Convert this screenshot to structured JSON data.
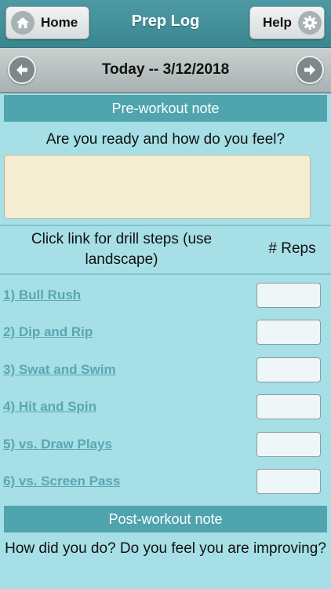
{
  "header": {
    "title": "Prep Log",
    "home_label": "Home",
    "help_label": "Help"
  },
  "icons": {
    "home": "home-icon",
    "help": "gear-icon",
    "prev": "arrow-left-icon",
    "next": "arrow-right-icon"
  },
  "date_nav": {
    "date_text": "Today -- 3/12/2018"
  },
  "pre_workout": {
    "heading": "Pre-workout note",
    "prompt": "Are you ready and how do you feel?"
  },
  "drills": {
    "column_title": "Click link for drill steps (use landscape)",
    "reps_title": "# Reps",
    "items": [
      {
        "label": "1) Bull Rush"
      },
      {
        "label": "2) Dip and Rip"
      },
      {
        "label": "3) Swat and Swim"
      },
      {
        "label": "4) Hit and Spin"
      },
      {
        "label": "5) vs. Draw Plays"
      },
      {
        "label": "6) vs. Screen Pass"
      }
    ]
  },
  "post_workout": {
    "heading": "Post-workout note",
    "prompt": "How did you do? Do you feel you are improving?"
  },
  "colors": {
    "header": "#3f8c96",
    "section": "#4fa4ae",
    "background": "#a6dfe6",
    "link": "#5aa7b2"
  }
}
